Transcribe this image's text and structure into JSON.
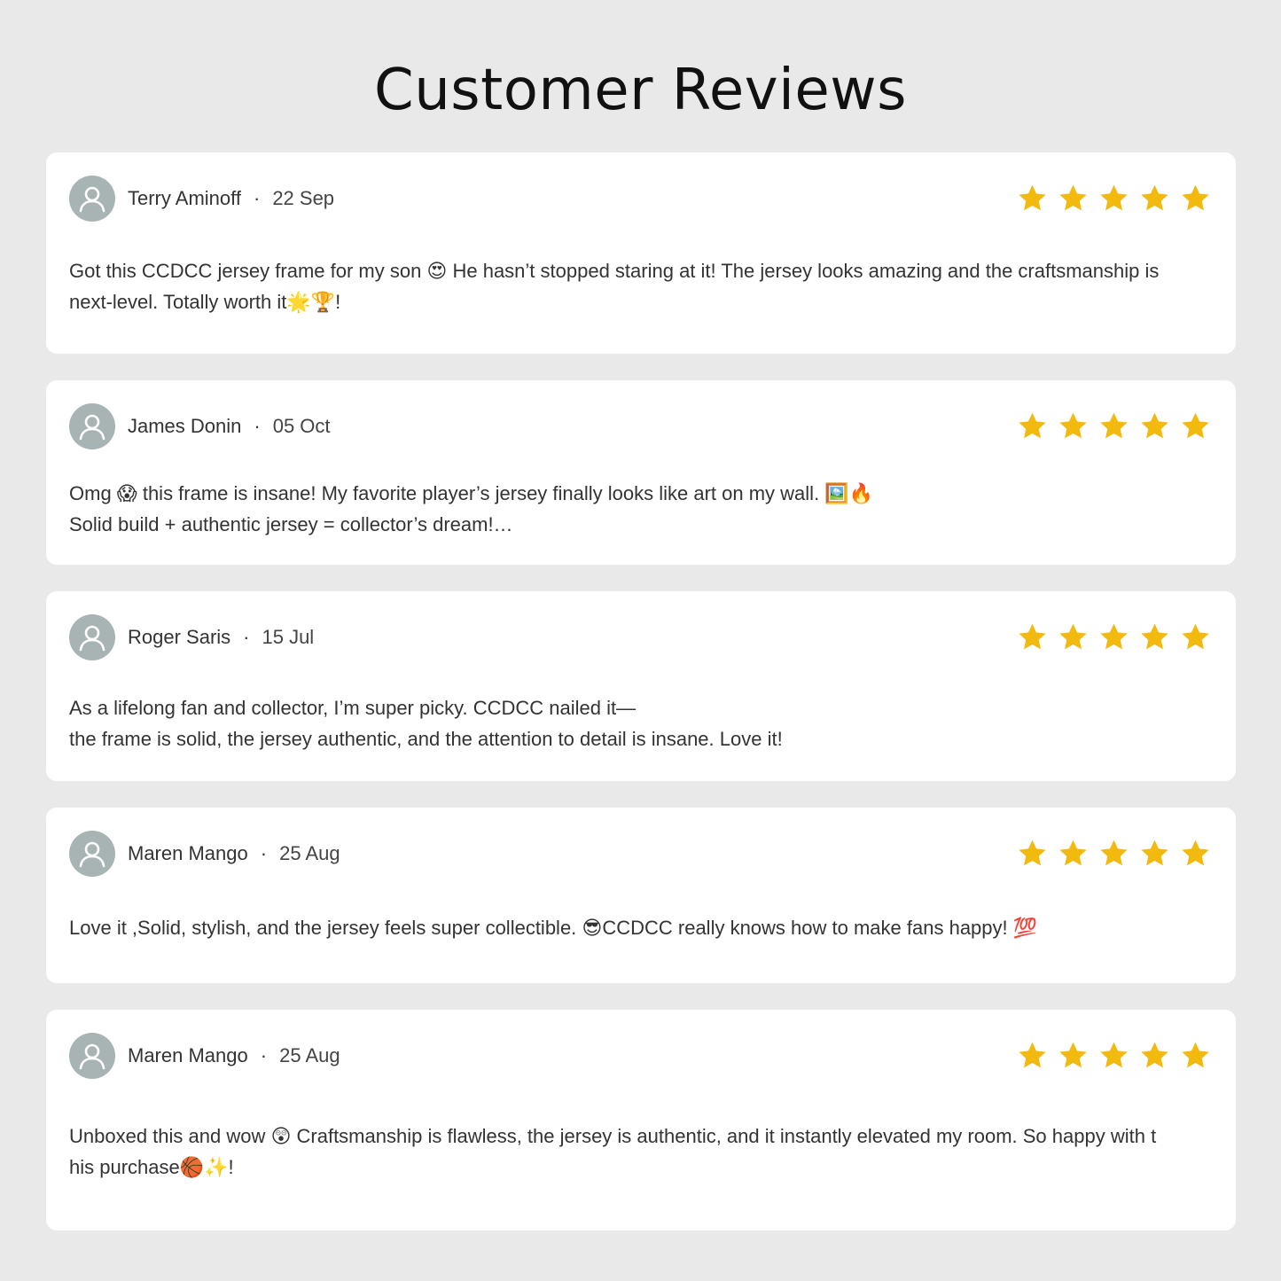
{
  "page": {
    "title": "Customer Reviews"
  },
  "colors": {
    "background": "#e9e9e9",
    "card": "#ffffff",
    "star": "#f2b90f",
    "avatar": "#a8b3b3"
  },
  "reviews": [
    {
      "name": "Terry Aminoff",
      "separator": "·",
      "date": "22 Sep",
      "rating": 5,
      "lines": [
        "Got this CCDCC jersey frame for my son 😍 He hasn’t stopped staring at it! The jersey looks amazing and the craftsmanship is",
        "next-level. Totally worth it🌟🏆!"
      ]
    },
    {
      "name": "James Donin",
      "separator": "·",
      "date": "05 Oct",
      "rating": 5,
      "lines": [
        "Omg 😱 this frame is insane! My favorite player’s jersey finally looks like art on my wall. 🖼️🔥",
        "Solid build + authentic jersey = collector’s dream!…"
      ]
    },
    {
      "name": "Roger Saris",
      "separator": "·",
      "date": "15 Jul",
      "rating": 5,
      "lines": [
        "As a lifelong fan and collector, I’m super picky. CCDCC nailed it—",
        "the frame is solid, the jersey authentic, and the attention to detail is insane. Love it!"
      ]
    },
    {
      "name": "Maren Mango",
      "separator": "·",
      "date": "25 Aug",
      "rating": 5,
      "lines": [
        "Love it ,Solid, stylish, and the jersey feels super collectible. 😎CCDCC really knows how to make fans happy! 💯"
      ]
    },
    {
      "name": "Maren Mango",
      "separator": "·",
      "date": "25 Aug",
      "rating": 5,
      "lines": [
        "Unboxed this and wow 😲 Craftsmanship is flawless, the jersey is authentic, and it instantly elevated my room. So happy with t",
        "his purchase🏀✨!"
      ]
    }
  ]
}
